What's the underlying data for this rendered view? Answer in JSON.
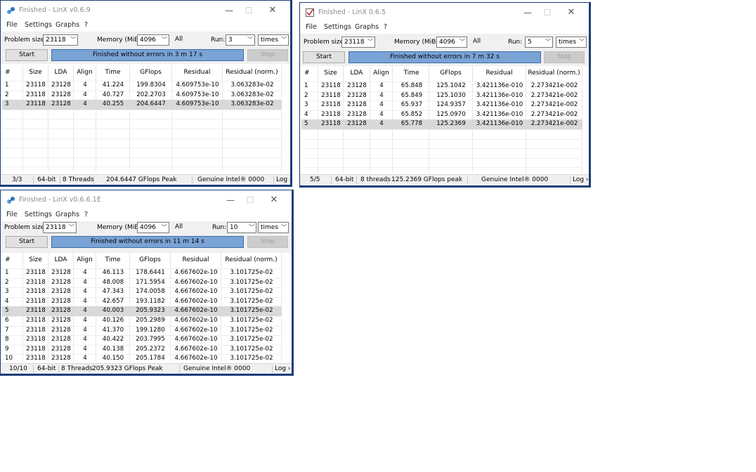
{
  "windows": [
    {
      "title": "Finished - LinX v0.6.9",
      "menu": [
        "File",
        "Settings",
        "Graphs",
        "?"
      ],
      "problem_size_label": "Problem size:",
      "problem_size": "23118",
      "memory_label": "Memory (MiB):",
      "memory": "4096",
      "all_label": "All",
      "run_label": "Run:",
      "run": "3",
      "run_unit": "times",
      "start_label": "Start",
      "status_message": "Finished without errors in 3 m 17 s",
      "stop_label": "Stop",
      "columns": [
        "#",
        "Size",
        "LDA",
        "Align",
        "Time",
        "GFlops",
        "Residual",
        "Residual (norm.)"
      ],
      "rows": [
        [
          "1",
          "23118",
          "23128",
          "4",
          "41.224",
          "199.8304",
          "4.609753e-10",
          "3.063283e-02"
        ],
        [
          "2",
          "23118",
          "23128",
          "4",
          "40.727",
          "202.2703",
          "4.609753e-10",
          "3.063283e-02"
        ],
        [
          "3",
          "23118",
          "23128",
          "4",
          "40.255",
          "204.6447",
          "4.609753e-10",
          "3.063283e-02"
        ]
      ],
      "selected_row": "3",
      "statusbar": {
        "progress": "3/3",
        "bits": "64-bit",
        "threads": "8 Threads",
        "peak": "204.6447 GFlops Peak",
        "cpu": "Genuine Intel® 0000",
        "log": "Log ›"
      }
    },
    {
      "title": "Finished - LinX 0.6.5",
      "menu": [
        "File",
        "Settings",
        "Graphs",
        "?"
      ],
      "problem_size_label": "Problem size:",
      "problem_size": "23118",
      "memory_label": "Memory (MiB):",
      "memory": "4096",
      "all_label": "All",
      "run_label": "Run:",
      "run": "5",
      "run_unit": "times",
      "start_label": "Start",
      "status_message": "Finished without errors in 7 m 32 s",
      "stop_label": "Stop",
      "columns": [
        "#",
        "Size",
        "LDA",
        "Align",
        "Time",
        "GFlops",
        "Residual",
        "Residual (norm.)"
      ],
      "rows": [
        [
          "1",
          "23118",
          "23128",
          "4",
          "65.848",
          "125.1042",
          "3.421136e-010",
          "2.273421e-002"
        ],
        [
          "2",
          "23118",
          "23128",
          "4",
          "65.849",
          "125.1030",
          "3.421136e-010",
          "2.273421e-002"
        ],
        [
          "3",
          "23118",
          "23128",
          "4",
          "65.937",
          "124.9357",
          "3.421136e-010",
          "2.273421e-002"
        ],
        [
          "4",
          "23118",
          "23128",
          "4",
          "65.852",
          "125.0970",
          "3.421136e-010",
          "2.273421e-002"
        ],
        [
          "5",
          "23118",
          "23128",
          "4",
          "65.778",
          "125.2369",
          "3.421136e-010",
          "2.273421e-002"
        ]
      ],
      "selected_row": "5",
      "statusbar": {
        "progress": "5/5",
        "bits": "64-bit",
        "threads": "8 threads",
        "peak": "125.2369 GFlops peak",
        "cpu": "Genuine Intel® 0000",
        "log": "Log ›"
      }
    },
    {
      "title": "Finished - LinX v0.6.6.1E",
      "menu": [
        "File",
        "Settings",
        "Graphs",
        "?"
      ],
      "problem_size_label": "Problem size:",
      "problem_size": "23118",
      "memory_label": "Memory (MiB):",
      "memory": "4096",
      "all_label": "All",
      "run_label": "Run:",
      "run": "10",
      "run_unit": "times",
      "start_label": "Start",
      "status_message": "Finished without errors in 11 m 14 s",
      "stop_label": "Stop",
      "columns": [
        "#",
        "Size",
        "LDA",
        "Align",
        "Time",
        "GFlops",
        "Residual",
        "Residual (norm.)"
      ],
      "rows": [
        [
          "1",
          "23118",
          "23128",
          "4",
          "46.113",
          "178.6441",
          "4.667602e-10",
          "3.101725e-02"
        ],
        [
          "2",
          "23118",
          "23128",
          "4",
          "48.008",
          "171.5954",
          "4.667602e-10",
          "3.101725e-02"
        ],
        [
          "3",
          "23118",
          "23128",
          "4",
          "47.343",
          "174.0058",
          "4.667602e-10",
          "3.101725e-02"
        ],
        [
          "4",
          "23118",
          "23128",
          "4",
          "42.657",
          "193.1182",
          "4.667602e-10",
          "3.101725e-02"
        ],
        [
          "5",
          "23118",
          "23128",
          "4",
          "40.003",
          "205.9323",
          "4.667602e-10",
          "3.101725e-02"
        ],
        [
          "6",
          "23118",
          "23128",
          "4",
          "40.126",
          "205.2989",
          "4.667602e-10",
          "3.101725e-02"
        ],
        [
          "7",
          "23118",
          "23128",
          "4",
          "41.370",
          "199.1280",
          "4.667602e-10",
          "3.101725e-02"
        ],
        [
          "8",
          "23118",
          "23128",
          "4",
          "40.422",
          "203.7995",
          "4.667602e-10",
          "3.101725e-02"
        ],
        [
          "9",
          "23118",
          "23128",
          "4",
          "40.138",
          "205.2372",
          "4.667602e-10",
          "3.101725e-02"
        ],
        [
          "10",
          "23118",
          "23128",
          "4",
          "40.150",
          "205.1784",
          "4.667602e-10",
          "3.101725e-02"
        ]
      ],
      "selected_row": "5",
      "statusbar": {
        "progress": "10/10",
        "bits": "64-bit",
        "threads": "8 Threads",
        "peak": "205.9323 GFlops Peak",
        "cpu": "Genuine Intel® 0000",
        "log": "Log ›"
      }
    }
  ],
  "colors": {
    "progress_fill": "#7aa3d6",
    "selected_row": "#d9d9d9",
    "window_border": "#1c3d7a"
  }
}
